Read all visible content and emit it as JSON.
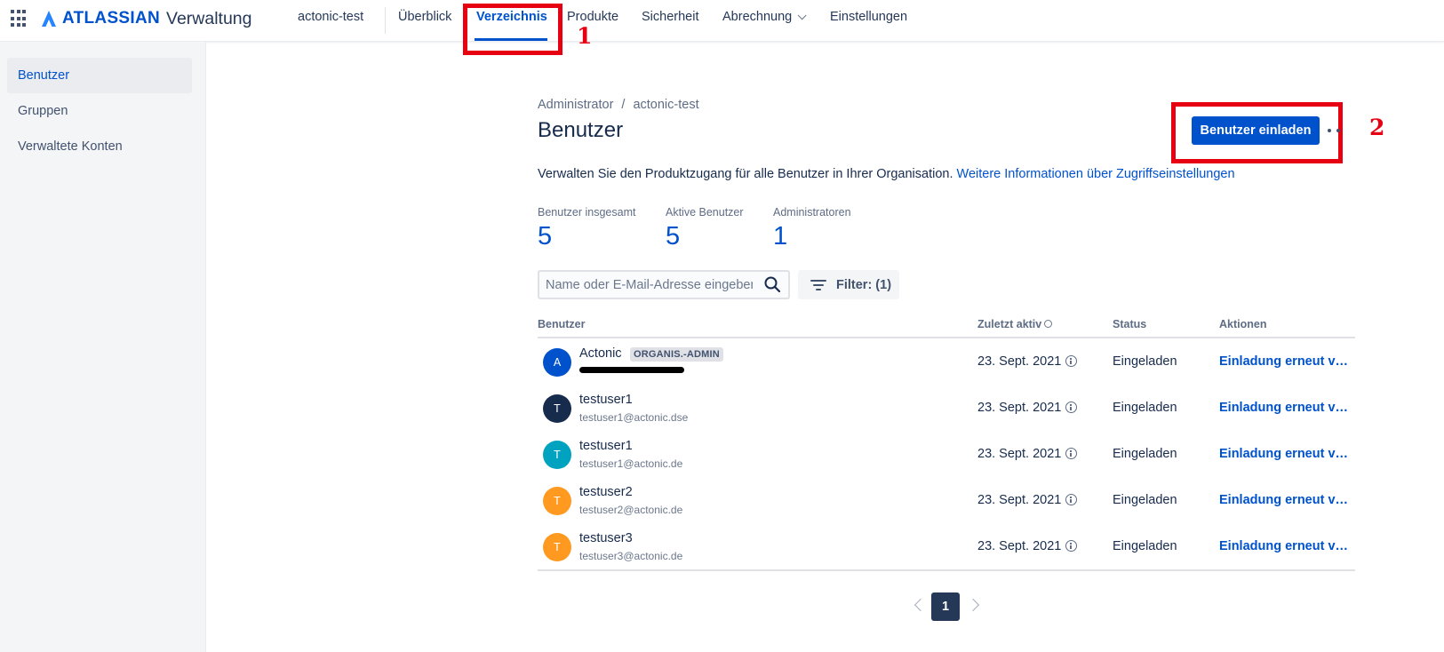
{
  "header": {
    "brand": "ATLASSIAN",
    "product": "Verwaltung",
    "org": "actonic-test",
    "nav": [
      {
        "label": "Überblick"
      },
      {
        "label": "Verzeichnis"
      },
      {
        "label": "Produkte"
      },
      {
        "label": "Sicherheit"
      },
      {
        "label": "Abrechnung"
      },
      {
        "label": "Einstellungen"
      }
    ]
  },
  "annotations": {
    "one": "1",
    "two": "2"
  },
  "sidebar": {
    "items": [
      {
        "label": "Benutzer"
      },
      {
        "label": "Gruppen"
      },
      {
        "label": "Verwaltete Konten"
      }
    ]
  },
  "main": {
    "breadcrumb": {
      "root": "Administrator",
      "separator": "/",
      "current": "actonic-test"
    },
    "title": "Benutzer",
    "invite_label": "Benutzer einladen",
    "description": "Verwalten Sie den Produktzugang für alle Benutzer in Ihrer Organisation.",
    "description_link": "Weitere Informationen über Zugriffseinstellungen",
    "stats": [
      {
        "label": "Benutzer insgesamt",
        "value": "5"
      },
      {
        "label": "Aktive Benutzer",
        "value": "5"
      },
      {
        "label": "Administratoren",
        "value": "1"
      }
    ],
    "search_placeholder": "Name oder E-Mail-Adresse eingeben",
    "filter_label": "Filter: (1)",
    "columns": [
      "Benutzer",
      "Zuletzt aktiv",
      "Status",
      "Aktionen"
    ],
    "rows": [
      {
        "initial": "A",
        "name": "Actonic",
        "badge": "ORGANIS.-ADMIN",
        "email": "",
        "last_active": "23. Sept. 2021",
        "status": "Eingeladen",
        "action": "Einladung erneut ver...",
        "avatar_color": "#0052cc"
      },
      {
        "initial": "T",
        "name": "testuser1",
        "email": "testuser1@actonic.dse",
        "last_active": "23. Sept. 2021",
        "status": "Eingeladen",
        "action": "Einladung erneut ver...",
        "avatar_color": "#172b4d"
      },
      {
        "initial": "T",
        "name": "testuser1",
        "email": "testuser1@actonic.de",
        "last_active": "23. Sept. 2021",
        "status": "Eingeladen",
        "action": "Einladung erneut ver...",
        "avatar_color": "#00a3bf"
      },
      {
        "initial": "T",
        "name": "testuser2",
        "email": "testuser2@actonic.de",
        "last_active": "23. Sept. 2021",
        "status": "Eingeladen",
        "action": "Einladung erneut ver...",
        "avatar_color": "#ff991f"
      },
      {
        "initial": "T",
        "name": "testuser3",
        "email": "testuser3@actonic.de",
        "last_active": "23. Sept. 2021",
        "status": "Eingeladen",
        "action": "Einladung erneut ver...",
        "avatar_color": "#ff991f"
      }
    ],
    "pagination": {
      "current": "1"
    }
  },
  "colors": {
    "accent": "#0052cc",
    "annotation": "#e60012"
  }
}
